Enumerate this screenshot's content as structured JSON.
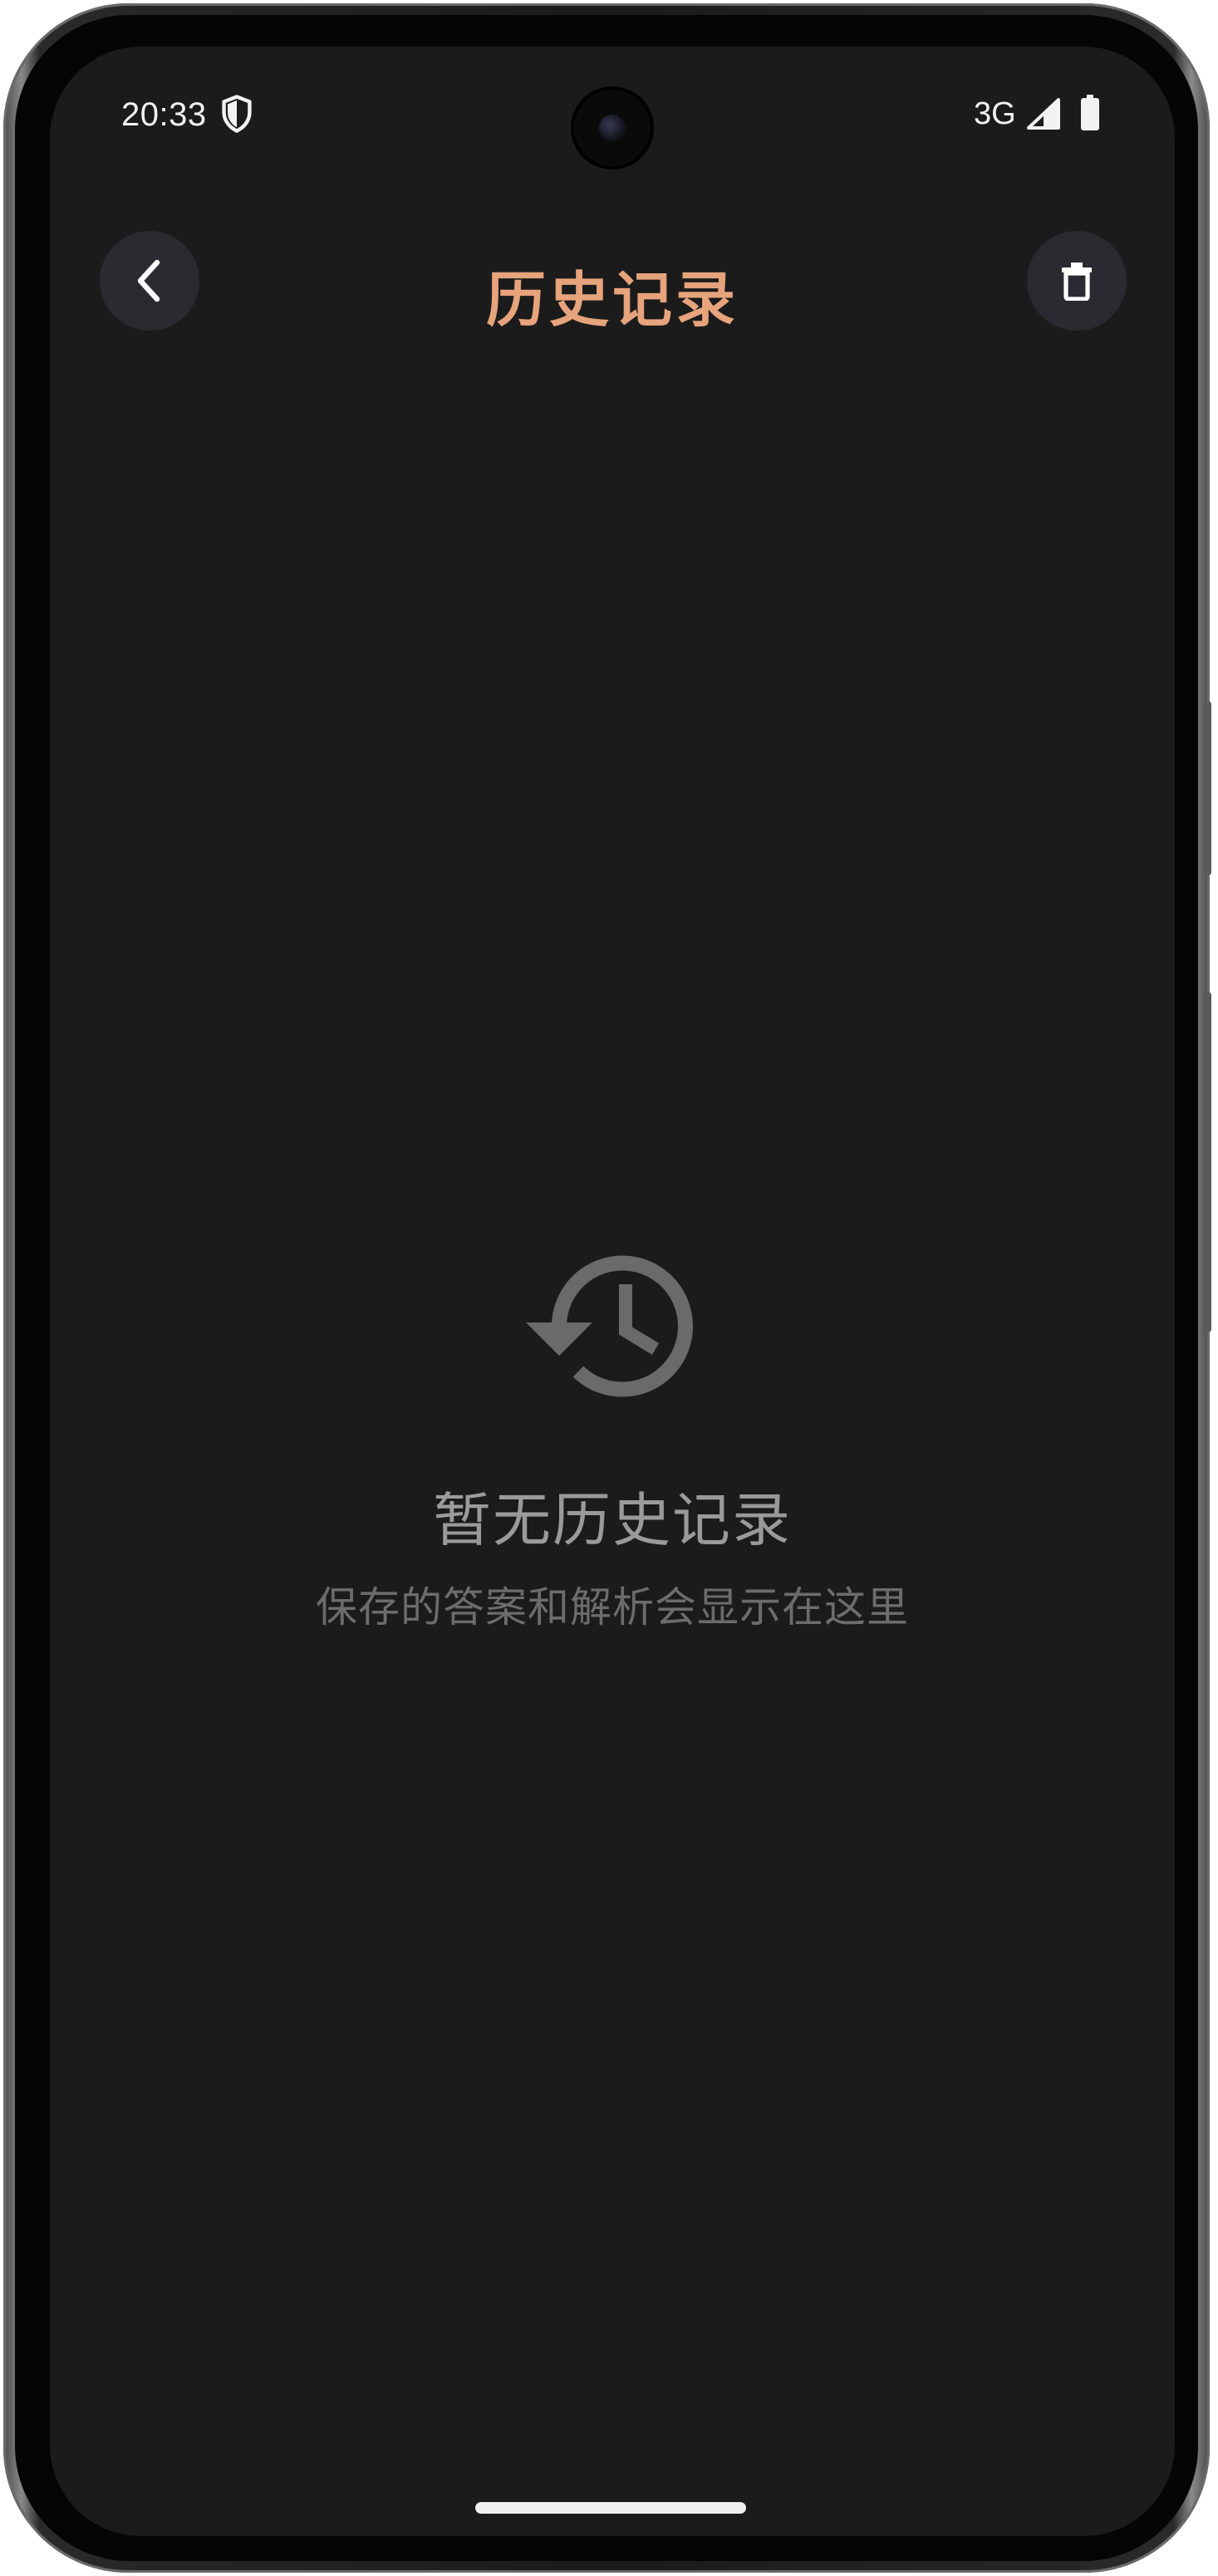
{
  "status_bar": {
    "time": "20:33",
    "network": "3G",
    "icons": [
      "shield-icon",
      "signal-icon",
      "battery-icon"
    ]
  },
  "header": {
    "title": "历史记录",
    "back_icon": "chevron-left-icon",
    "delete_icon": "trash-icon"
  },
  "empty_state": {
    "icon": "history-icon",
    "title": "暂无历史记录",
    "subtitle": "保存的答案和解析会显示在这里"
  },
  "colors": {
    "title_accent": "#e6a37c",
    "background": "#1b1b1b",
    "button_bg": "#2b2a30",
    "empty_text": "#9a9a9a",
    "empty_subtext": "#6c6c6c"
  }
}
